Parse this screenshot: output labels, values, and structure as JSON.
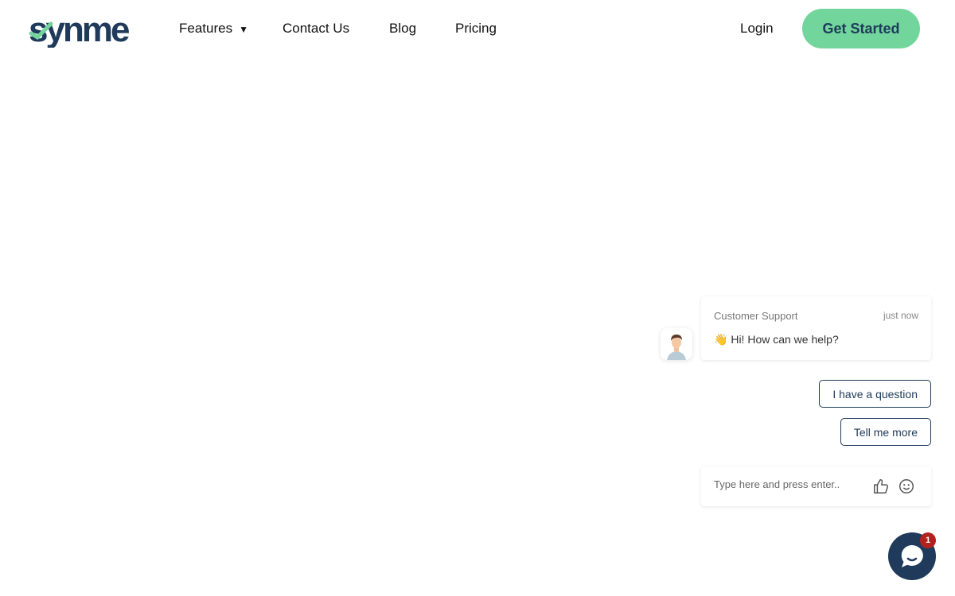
{
  "brand": {
    "name": "Synme",
    "navy": "#1f3a5a",
    "green": "#72d59c"
  },
  "nav": {
    "items": [
      {
        "label": "Features",
        "dropdown": true
      },
      {
        "label": "Contact Us"
      },
      {
        "label": "Blog"
      },
      {
        "label": "Pricing"
      }
    ],
    "login": "Login",
    "cta": "Get Started"
  },
  "chat": {
    "sender": "Customer Support",
    "time": "just now",
    "emoji": "👋",
    "message": "Hi! How can we help?",
    "quick_replies": [
      "I have a question",
      "Tell me more"
    ],
    "input_placeholder": "Type here and press enter..",
    "icons": [
      "thumbs-up-icon",
      "smiley-icon"
    ],
    "unread_count": "1",
    "badge_color": "#b3211e"
  }
}
